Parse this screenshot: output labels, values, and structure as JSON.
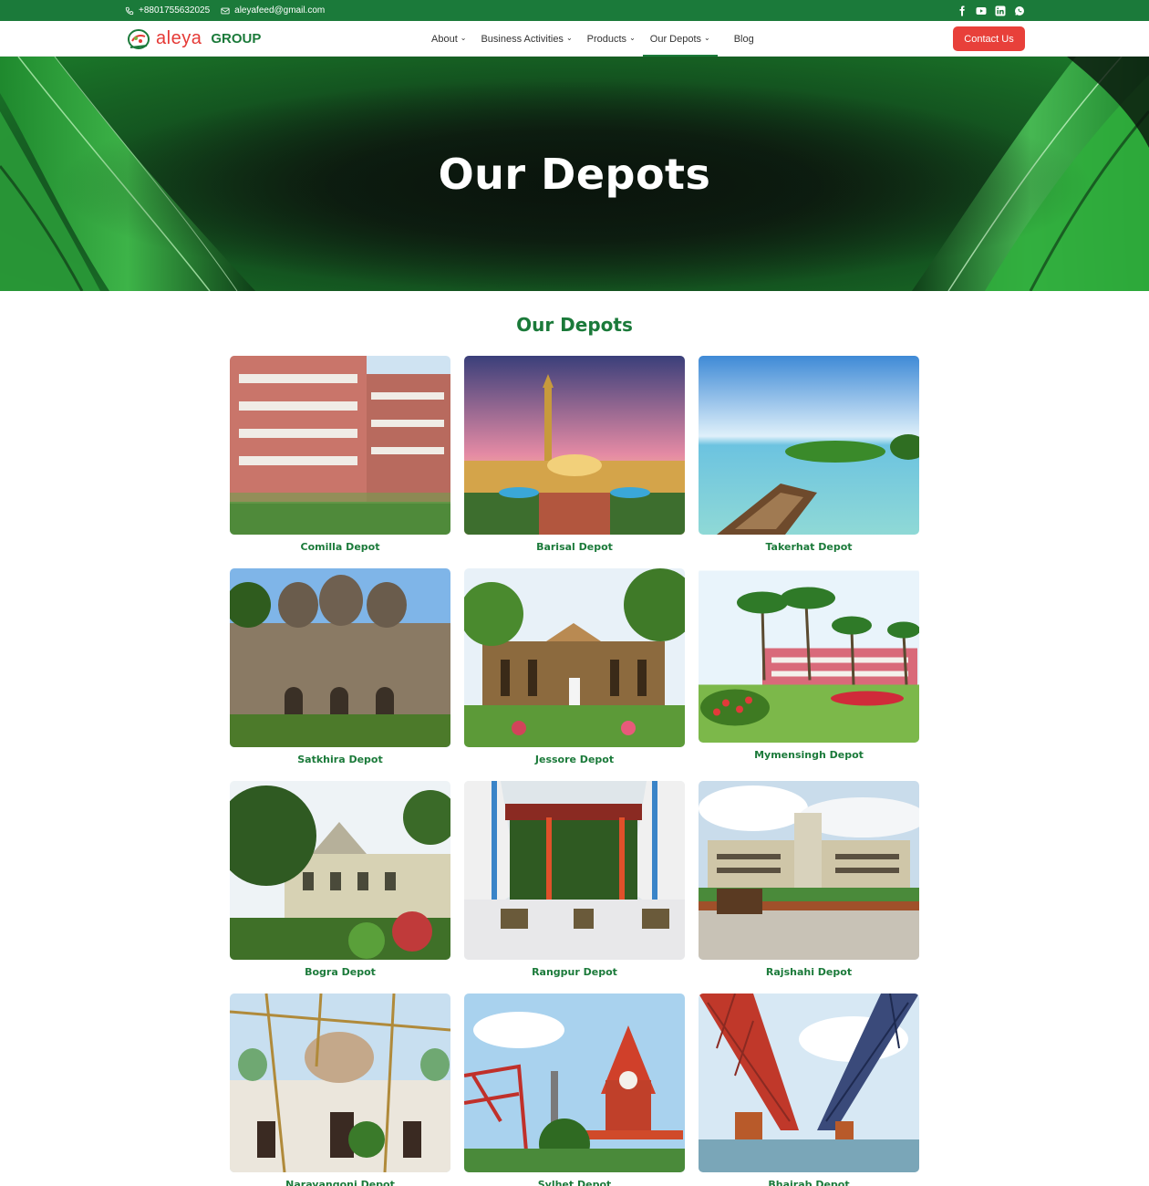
{
  "topbar": {
    "phone": "+8801755632025",
    "email": "aleyafeed@gmail.com",
    "social": [
      "facebook-icon",
      "youtube-icon",
      "linkedin-icon",
      "whatsapp-icon"
    ]
  },
  "nav": {
    "brand": "aleya",
    "group": "GROUP",
    "items": [
      {
        "label": "About",
        "dropdown": true
      },
      {
        "label": "Business Activities",
        "dropdown": true
      },
      {
        "label": "Products",
        "dropdown": true
      },
      {
        "label": "Our Depots",
        "dropdown": true,
        "active": true
      },
      {
        "label": "Blog",
        "dropdown": false
      }
    ],
    "contact_label": "Contact Us"
  },
  "hero": {
    "title": "Our Depots"
  },
  "section": {
    "title": "Our Depots"
  },
  "depots": [
    {
      "name": "Comilla Depot"
    },
    {
      "name": "Barisal Depot"
    },
    {
      "name": "Takerhat Depot"
    },
    {
      "name": "Satkhira Depot"
    },
    {
      "name": "Jessore Depot"
    },
    {
      "name": "Mymensingh Depot"
    },
    {
      "name": "Bogra Depot"
    },
    {
      "name": "Rangpur Depot"
    },
    {
      "name": "Rajshahi Depot"
    },
    {
      "name": "Narayangonj Depot"
    },
    {
      "name": "Sylhet Depot"
    },
    {
      "name": "Bhairab Depot"
    }
  ],
  "colors": {
    "primary_green": "#1b7a3a",
    "accent_red": "#e8403a"
  }
}
